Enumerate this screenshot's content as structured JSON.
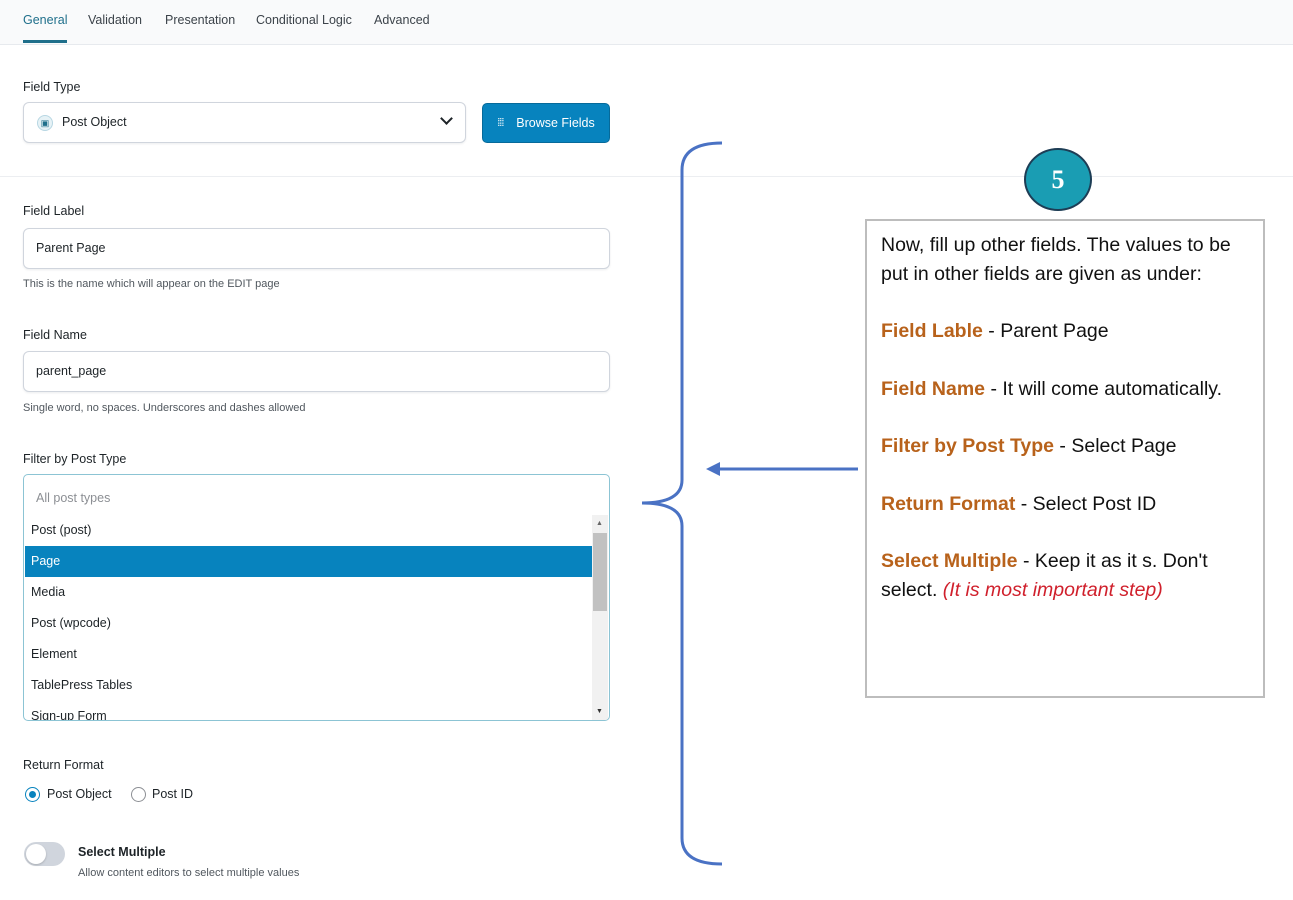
{
  "tabs": [
    "General",
    "Validation",
    "Presentation",
    "Conditional Logic",
    "Advanced"
  ],
  "active_tab": "General",
  "field_type": {
    "label": "Field Type",
    "value": "Post Object",
    "browse_label": "Browse Fields"
  },
  "field_label": {
    "label": "Field Label",
    "value": "Parent Page",
    "help": "This is the name which will appear on the EDIT page"
  },
  "field_name": {
    "label": "Field Name",
    "value": "parent_page",
    "help": "Single word, no spaces. Underscores and dashes allowed"
  },
  "filter_post_type": {
    "label": "Filter by Post Type",
    "placeholder": "All post types",
    "options": [
      "Post (post)",
      "Page",
      "Media",
      "Post (wpcode)",
      "Element",
      "TablePress Tables",
      "Sign-up Form"
    ],
    "selected": "Page"
  },
  "return_format": {
    "label": "Return Format",
    "options": [
      "Post Object",
      "Post ID"
    ],
    "selected": "Post Object"
  },
  "select_multiple": {
    "label": "Select Multiple",
    "help": "Allow content editors to select multiple values",
    "enabled": false
  },
  "annotation": {
    "step": "5",
    "intro": "Now, fill up other fields. The values to be put in other fields are given as under:",
    "items": [
      {
        "key": "Field Lable",
        "text": " - Parent Page"
      },
      {
        "key": "Field Name",
        "text": " - It will come automatically."
      },
      {
        "key": "Filter by Post Type",
        "text": " - Select Page"
      },
      {
        "key": "Return Format",
        "text": " - Select Post ID"
      },
      {
        "key": "Select Multiple",
        "text": " - Keep it as it s. Don't select. ",
        "note": "(It is most important step)"
      }
    ]
  },
  "colors": {
    "accent": "#0783be",
    "tab_active": "#1f6f8b",
    "brace": "#4a72c4",
    "key_text": "#b8621b",
    "note_text": "#d0202c",
    "badge": "#1a9db3"
  }
}
